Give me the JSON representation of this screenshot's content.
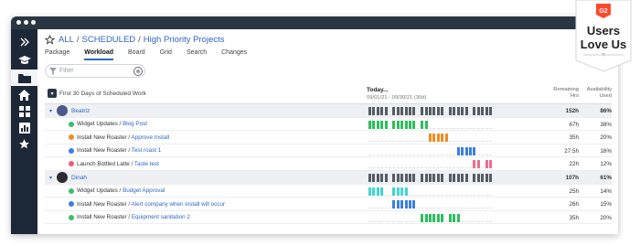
{
  "breadcrumb": {
    "all": "ALL",
    "scheduled": "SCHEDULED",
    "project": "High Priority Projects",
    "sep": "/"
  },
  "tabs": [
    "Package",
    "Workload",
    "Board",
    "Grid",
    "Search",
    "Changes"
  ],
  "active_tab": "Workload",
  "filter": {
    "placeholder": "Filter",
    "clear": "⊗"
  },
  "sidebar_icons": [
    "collapse-icon",
    "graduation-cap-icon",
    "folder-icon",
    "home-icon",
    "grid-icon",
    "report-icon",
    "star-icon"
  ],
  "grid": {
    "header_title": "First 30 Days of Scheduled Work",
    "today": "Today...",
    "range": "09/01/21 - 09/30/21 (30d)",
    "col_remaining": "Remaining Hrs",
    "col_availability": "Availability Used",
    "rows": [
      {
        "kind": "person",
        "name": "Beatriz",
        "hrs": "152h",
        "pct": "86%",
        "avatar_color": "#4a5a8a",
        "bar_color": "#555c66",
        "bars": [
          [
            0,
            4
          ],
          [
            6,
            11
          ],
          [
            13,
            18
          ],
          [
            20,
            24
          ],
          [
            26,
            30
          ]
        ]
      },
      {
        "kind": "task",
        "status": "#3bbf6a",
        "prefix": "Widget Updates",
        "link": "Blog Post",
        "hrs": "67h",
        "pct": "38%",
        "bar_color": "#2dbf5b",
        "bars": [
          [
            0,
            4
          ],
          [
            6,
            11
          ],
          [
            13,
            14
          ]
        ]
      },
      {
        "kind": "task",
        "status": "#f28b22",
        "prefix": "Install New Roaster",
        "link": "Approve Install",
        "hrs": "35h",
        "pct": "20%",
        "bar_color": "#f28b22",
        "bars": [
          [
            15,
            19
          ]
        ]
      },
      {
        "kind": "task",
        "status": "#3b7fe0",
        "prefix": "Install New Roaster",
        "link": "Test roast 1",
        "hrs": "27.5h",
        "pct": "16%",
        "bar_color": "#3b7fe0",
        "bars": [
          [
            22,
            26
          ]
        ]
      },
      {
        "kind": "task",
        "status": "#ee5b76",
        "prefix": "Launch Bottled Latte",
        "link": "Taste test",
        "hrs": "22h",
        "pct": "12%",
        "bar_color": "#ee6f8a",
        "bars": [
          [
            26,
            27
          ],
          [
            29,
            30
          ]
        ]
      },
      {
        "kind": "person",
        "name": "Dinah",
        "hrs": "107h",
        "pct": "61%",
        "avatar_color": "#2c2c36",
        "bar_color": "#555c66",
        "bars": [
          [
            0,
            4
          ],
          [
            6,
            11
          ],
          [
            13,
            18
          ],
          [
            20,
            24
          ],
          [
            26,
            30
          ]
        ]
      },
      {
        "kind": "task",
        "status": "#3bbf6a",
        "prefix": "Widget Updates",
        "link": "Budget Approval",
        "hrs": "25h",
        "pct": "14%",
        "bar_color": "#3fd6d0",
        "bars": [
          [
            0,
            3
          ],
          [
            6,
            9
          ]
        ]
      },
      {
        "kind": "task",
        "status": "#3b7fe0",
        "prefix": "Install New Roaster",
        "link": "Alert company when install will occur",
        "hrs": "26h",
        "pct": "15%",
        "bar_color": "#3b7fe0",
        "bars": [
          [
            6,
            11
          ]
        ]
      },
      {
        "kind": "task",
        "status": "#3bbf6a",
        "prefix": "Install New Roaster",
        "link": "Equipment sanitation 2",
        "hrs": "35h",
        "pct": "20%",
        "bar_color": "#2dbf5b",
        "bars": [
          [
            13,
            14
          ],
          [
            15,
            18
          ],
          [
            20,
            22
          ]
        ]
      }
    ]
  },
  "badge": {
    "line1": "Users",
    "line2": "Love Us",
    "brand": "G2",
    "accent": "#ff492c"
  }
}
